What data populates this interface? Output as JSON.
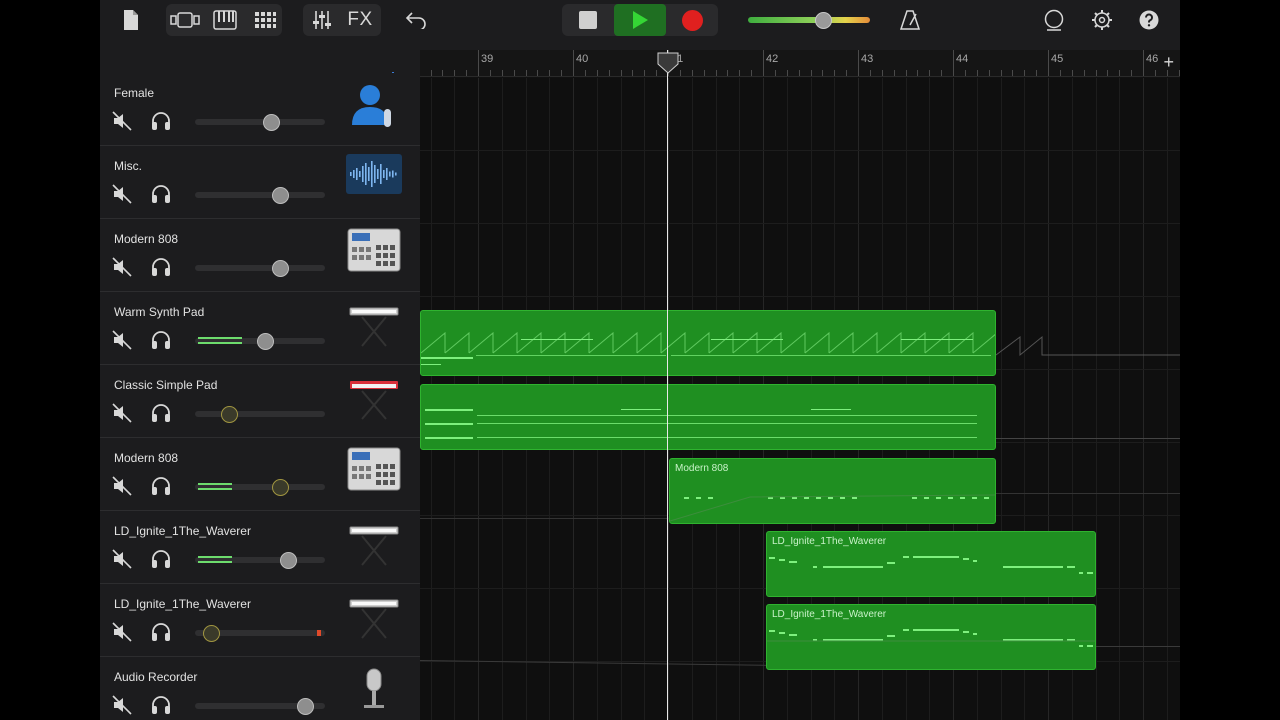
{
  "toolbar": {
    "fx_label": "FX"
  },
  "ruler": {
    "bars": [
      "39",
      "40",
      "41",
      "42",
      "43",
      "44",
      "45",
      "46"
    ]
  },
  "tracks": [
    {
      "name": "Female",
      "instrument": "vocalist-icon",
      "volume": 0.6
    },
    {
      "name": "Misc.",
      "instrument": "waveform-icon",
      "volume": 0.68
    },
    {
      "name": "Modern 808",
      "instrument": "drum-machine-icon",
      "volume": 0.68
    },
    {
      "name": "Warm Synth Pad",
      "instrument": "keyboard-stand-icon",
      "volume": 0.55
    },
    {
      "name": "Classic Simple Pad",
      "instrument": "red-keyboard-icon",
      "volume": 0.23
    },
    {
      "name": "Modern 808",
      "instrument": "drum-machine-icon",
      "volume": 0.68
    },
    {
      "name": "LD_Ignite_1The_Waverer",
      "instrument": "keyboard-stand-icon",
      "volume": 0.75
    },
    {
      "name": "LD_Ignite_1The_Waverer",
      "instrument": "keyboard-stand-icon",
      "volume": 0.07
    },
    {
      "name": "Audio Recorder",
      "instrument": "microphone-icon",
      "volume": 0.9
    }
  ],
  "regions": {
    "modern808": "Modern 808",
    "ld_ignite_1": "LD_Ignite_1The_Waverer",
    "ld_ignite_2": "LD_Ignite_1The_Waverer"
  },
  "colors": {
    "region_green": "#1f8f21",
    "note_green": "#7ef07e",
    "record_red": "#e0201f",
    "play_green": "#35d635"
  }
}
